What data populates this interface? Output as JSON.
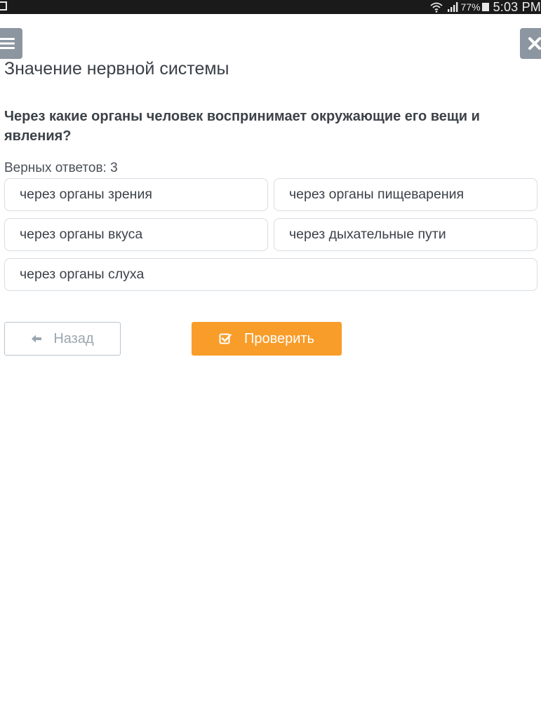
{
  "status_bar": {
    "battery": "77%",
    "time": "5:03 PM",
    "icons": [
      "notification-icon",
      "wifi-icon",
      "signal-icon",
      "battery-icon"
    ]
  },
  "header": {
    "menu_icon": "menu-icon",
    "close_icon": "close-icon"
  },
  "page": {
    "title": "Значение нервной системы",
    "question": "Через какие органы человек воспринимает окружающие его вещи и явления?",
    "hint": "Верных ответов: 3"
  },
  "options": [
    {
      "label": "через органы зрения"
    },
    {
      "label": "через органы пищеварения"
    },
    {
      "label": "через органы вкуса"
    },
    {
      "label": "через дыхательные пути"
    },
    {
      "label": "через органы слуха"
    }
  ],
  "actions": {
    "back_label": "Назад",
    "back_icon": "arrow-left-icon",
    "check_label": "Проверить",
    "check_icon": "check-square-icon"
  },
  "colors": {
    "accent": "#f99d2a",
    "header_button": "#8c96a0",
    "status_bar": "#1a1a1a",
    "option_border": "#d8dde2"
  }
}
